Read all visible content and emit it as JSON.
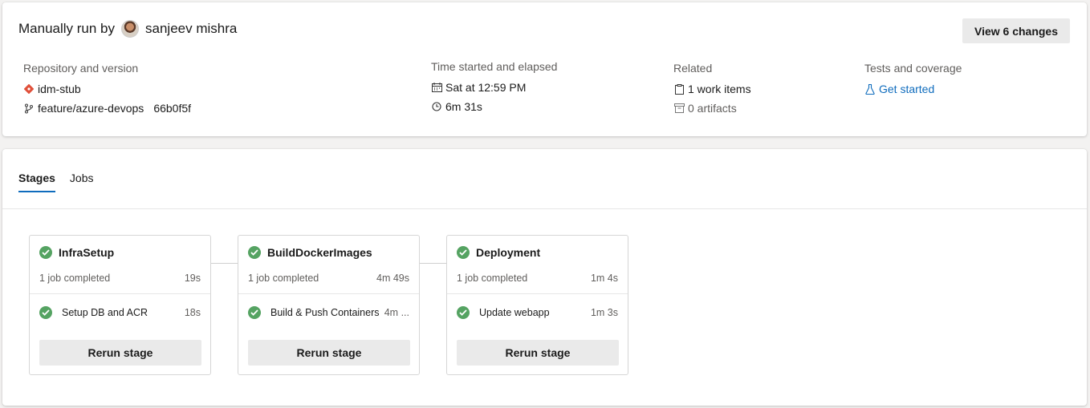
{
  "summary": {
    "title_prefix": "Manually run by",
    "user_name": "sanjeev mishra",
    "view_changes_label": "View 6 changes",
    "repository": {
      "label": "Repository and version",
      "repo_name": "idm-stub",
      "branch": "feature/azure-devops",
      "commit": "66b0f5f"
    },
    "time": {
      "label": "Time started and elapsed",
      "started": "Sat at 12:59 PM",
      "elapsed": "6m 31s"
    },
    "related": {
      "label": "Related",
      "work_items": "1 work items",
      "artifacts": "0 artifacts"
    },
    "tests": {
      "label": "Tests and coverage",
      "link": "Get started"
    }
  },
  "tabs": [
    {
      "label": "Stages"
    },
    {
      "label": "Jobs"
    }
  ],
  "stages": [
    {
      "name": "InfraSetup",
      "status_text": "1 job completed",
      "duration": "19s",
      "job": {
        "name": "Setup DB and ACR",
        "duration": "18s"
      },
      "rerun_label": "Rerun stage"
    },
    {
      "name": "BuildDockerImages",
      "status_text": "1 job completed",
      "duration": "4m 49s",
      "job": {
        "name": "Build & Push Containers",
        "duration": "4m ..."
      },
      "rerun_label": "Rerun stage"
    },
    {
      "name": "Deployment",
      "status_text": "1 job completed",
      "duration": "1m 4s",
      "job": {
        "name": "Update webapp",
        "duration": "1m 3s"
      },
      "rerun_label": "Rerun stage"
    }
  ],
  "colors": {
    "success": "#55a362",
    "link": "#0f6cbd",
    "git_brand": "#e0503a"
  }
}
